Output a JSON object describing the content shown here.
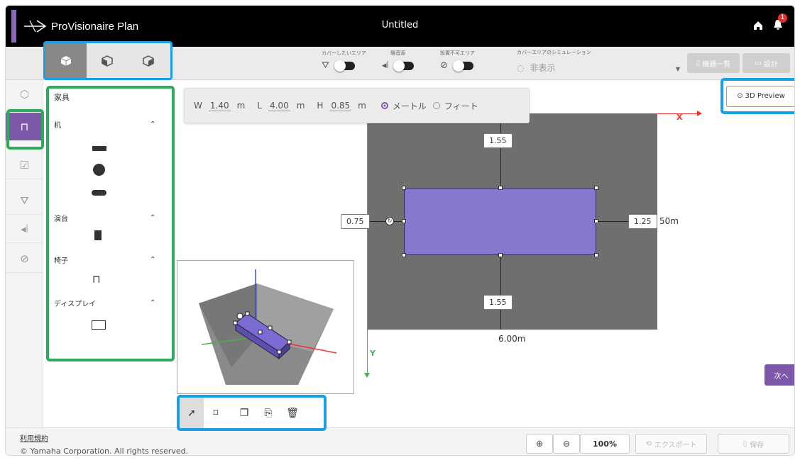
{
  "app": {
    "logo_text": "ProVisionaire Plan",
    "title": "Untitled",
    "notification_count": "1"
  },
  "toolbar": {
    "toggles": [
      {
        "label": "カバーしたいエリア",
        "icon": "area-icon"
      },
      {
        "label": "騒音源",
        "icon": "noise-icon"
      },
      {
        "label": "設置不可エリア",
        "icon": "no-install-icon"
      }
    ],
    "simulation": {
      "label": "カバーエリアのシミュレーション",
      "value": "非表示"
    },
    "equipment_list_label": "機器一覧",
    "design_label": "設計"
  },
  "panel": {
    "header": "家具",
    "categories": [
      {
        "label": "机"
      },
      {
        "label": "演台"
      },
      {
        "label": "椅子"
      },
      {
        "label": "ディスプレイ"
      }
    ]
  },
  "dimensions": {
    "w_label": "W",
    "w_value": "1.40",
    "w_unit": "m",
    "l_label": "L",
    "l_value": "4.00",
    "l_unit": "m",
    "h_label": "H",
    "h_value": "0.85",
    "h_unit": "m",
    "unit_meter": "メートル",
    "unit_feet": "フィート"
  },
  "canvas": {
    "top_distance": "1.55",
    "bottom_distance": "1.55",
    "left_distance": "0.75",
    "right_distance": "1.25",
    "room_width": "6.00m",
    "room_depth_partial": "50m",
    "x_axis": "X",
    "y_axis": "Y"
  },
  "preview_button_label": "3D Preview",
  "next_button_label": "次へ",
  "footer": {
    "terms": "利用規約",
    "copyright": "© Yamaha Corporation. All rights reserved.",
    "zoom": "100%",
    "export_label": "エクスポート",
    "save_label": "保存"
  },
  "colors": {
    "accent": "#7d57a8",
    "furniture": "#8678cf",
    "callout_blue": "#1a9ee8",
    "callout_green": "#2eaa5b"
  }
}
